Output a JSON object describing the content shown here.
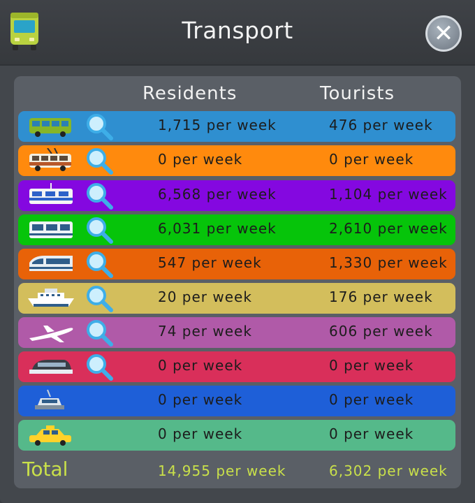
{
  "window": {
    "title": "Transport",
    "close_icon": "close-icon",
    "title_icon": "bus-icon"
  },
  "headers": {
    "residents": "Residents",
    "tourists": "Tourists"
  },
  "rows": [
    {
      "icon": "bus-icon",
      "color": "#2f8fd0",
      "residents": "1,715 per week",
      "tourists": "476 per week",
      "has_zoom": true
    },
    {
      "icon": "trolleybus-icon",
      "color": "#ff8a0d",
      "residents": "0 per week",
      "tourists": "0 per week",
      "has_zoom": true
    },
    {
      "icon": "tram-icon",
      "color": "#8408e0",
      "residents": "6,568 per week",
      "tourists": "1,104 per week",
      "has_zoom": true
    },
    {
      "icon": "metro-icon",
      "color": "#06c40a",
      "residents": "6,031 per week",
      "tourists": "2,610 per week",
      "has_zoom": true
    },
    {
      "icon": "train-icon",
      "color": "#e86208",
      "residents": "547 per week",
      "tourists": "1,330 per week",
      "has_zoom": true
    },
    {
      "icon": "ship-icon",
      "color": "#d3be5c",
      "residents": "20 per week",
      "tourists": "176 per week",
      "has_zoom": true
    },
    {
      "icon": "airplane-icon",
      "color": "#b05aa8",
      "residents": "74 per week",
      "tourists": "606 per week",
      "has_zoom": true
    },
    {
      "icon": "monorail-icon",
      "color": "#d92f5a",
      "residents": "0 per week",
      "tourists": "0 per week",
      "has_zoom": true
    },
    {
      "icon": "cable-car-icon",
      "color": "#1e5fd8",
      "residents": "0 per week",
      "tourists": "0 per week",
      "has_zoom": false
    },
    {
      "icon": "taxi-icon",
      "color": "#55b98a",
      "residents": "0 per week",
      "tourists": "0 per week",
      "has_zoom": false
    }
  ],
  "total": {
    "label": "Total",
    "residents": "14,955 per week",
    "tourists": "6,302 per week",
    "color": "#c9e04a"
  }
}
